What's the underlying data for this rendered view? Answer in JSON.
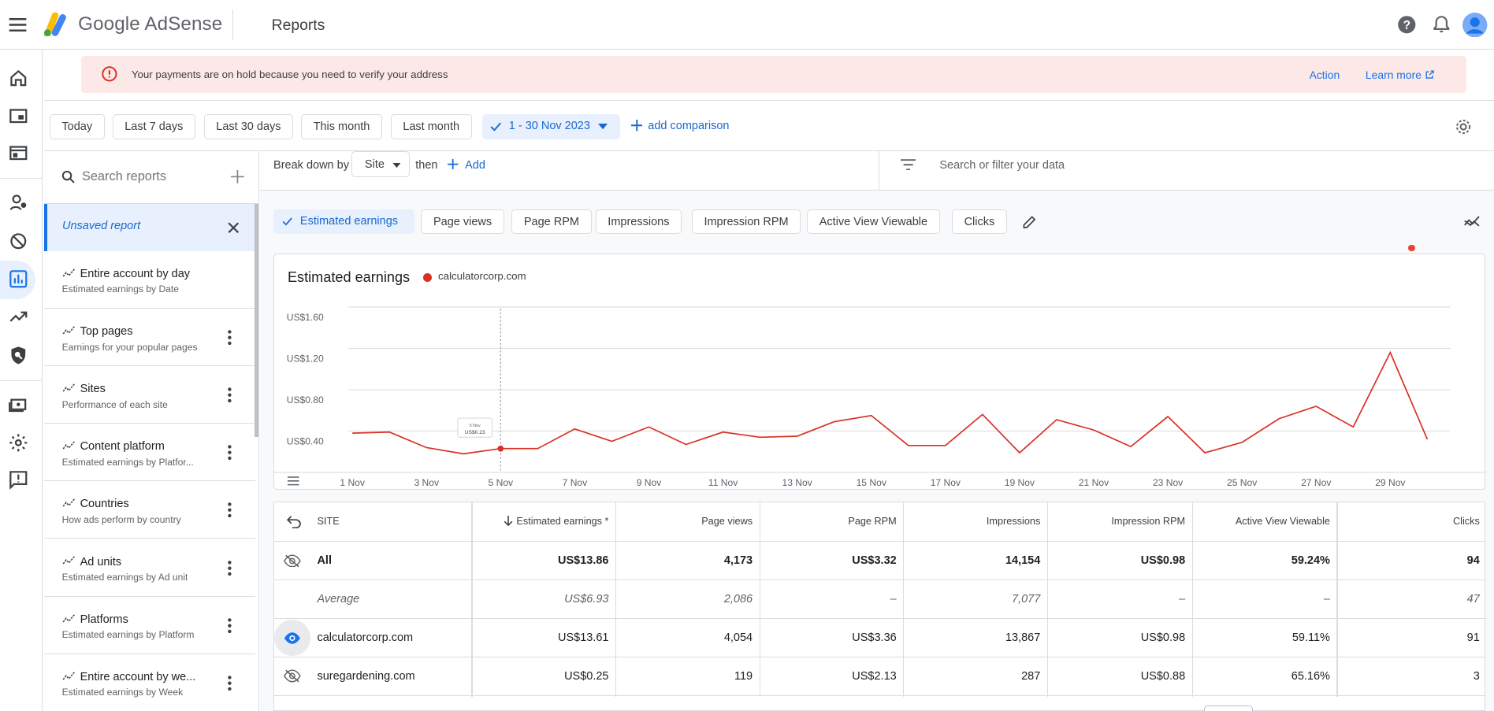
{
  "header": {
    "brand": "Google AdSense",
    "page_title": "Reports"
  },
  "alert": {
    "message": "Your payments are on hold because you need to verify your address",
    "action_label": "Action",
    "learn_more_label": "Learn more"
  },
  "date_bar": {
    "presets": [
      "Today",
      "Last 7 days",
      "Last 30 days",
      "This month",
      "Last month"
    ],
    "selected_range": "1 - 30 Nov 2023",
    "add_comparison": "add comparison"
  },
  "reports_panel": {
    "search_placeholder": "Search reports",
    "unsaved_label": "Unsaved report",
    "items": [
      {
        "title": "Entire account by day",
        "subtitle": "Estimated earnings by Date"
      },
      {
        "title": "Top pages",
        "subtitle": "Earnings for your popular pages"
      },
      {
        "title": "Sites",
        "subtitle": "Performance of each site"
      },
      {
        "title": "Content platform",
        "subtitle": "Estimated earnings by Platfor..."
      },
      {
        "title": "Countries",
        "subtitle": "How ads perform by country"
      },
      {
        "title": "Ad units",
        "subtitle": "Estimated earnings by Ad unit"
      },
      {
        "title": "Platforms",
        "subtitle": "Estimated earnings by Platform"
      },
      {
        "title": "Entire account by we...",
        "subtitle": "Estimated earnings by Week"
      }
    ]
  },
  "breakdown": {
    "label": "Break down by",
    "dimension": "Site",
    "then_label": "then",
    "add_label": "Add",
    "filter_placeholder": "Search or filter your data"
  },
  "metrics": {
    "active": "Estimated earnings",
    "others": [
      "Page views",
      "Page RPM",
      "Impressions",
      "Impression RPM",
      "Active View Viewable",
      "Clicks"
    ]
  },
  "chart_data": {
    "type": "line",
    "title": "Estimated earnings",
    "series": [
      {
        "name": "calculatorcorp.com",
        "color": "#d93025",
        "values": [
          0.38,
          0.39,
          0.24,
          0.18,
          0.23,
          0.23,
          0.42,
          0.3,
          0.44,
          0.27,
          0.39,
          0.34,
          0.35,
          0.49,
          0.55,
          0.26,
          0.26,
          0.56,
          0.19,
          0.51,
          0.41,
          0.25,
          0.54,
          0.19,
          0.29,
          0.52,
          0.64,
          0.44,
          1.16,
          0.32
        ]
      }
    ],
    "x_tick_labels": [
      "1 Nov",
      "3 Nov",
      "5 Nov",
      "7 Nov",
      "9 Nov",
      "11 Nov",
      "13 Nov",
      "15 Nov",
      "17 Nov",
      "19 Nov",
      "21 Nov",
      "23 Nov",
      "25 Nov",
      "27 Nov",
      "29 Nov"
    ],
    "y_tick_labels": [
      "US$1.60",
      "US$1.20",
      "US$0.80",
      "US$0.40"
    ],
    "ylim": [
      0,
      1.6
    ],
    "hover_day": "5 Nov",
    "hover_value": "US$0.23",
    "grid": true
  },
  "table": {
    "columns": [
      "SITE",
      "Estimated earnings *",
      "Page views",
      "Page RPM",
      "Impressions",
      "Impression RPM",
      "Active View Viewable",
      "Clicks"
    ],
    "rows": [
      {
        "type": "total",
        "site": "All",
        "values": [
          "US$13.86",
          "4,173",
          "US$3.32",
          "14,154",
          "US$0.98",
          "59.24%",
          "94"
        ]
      },
      {
        "type": "average",
        "site": "Average",
        "values": [
          "US$6.93",
          "2,086",
          "–",
          "7,077",
          "–",
          "–",
          "47"
        ]
      },
      {
        "type": "site",
        "site": "calculatorcorp.com",
        "values": [
          "US$13.61",
          "4,054",
          "US$3.36",
          "13,867",
          "US$0.98",
          "59.11%",
          "91"
        ]
      },
      {
        "type": "site",
        "site": "suregardening.com",
        "values": [
          "US$0.25",
          "119",
          "US$2.13",
          "287",
          "US$0.88",
          "65.16%",
          "3"
        ]
      }
    ]
  }
}
